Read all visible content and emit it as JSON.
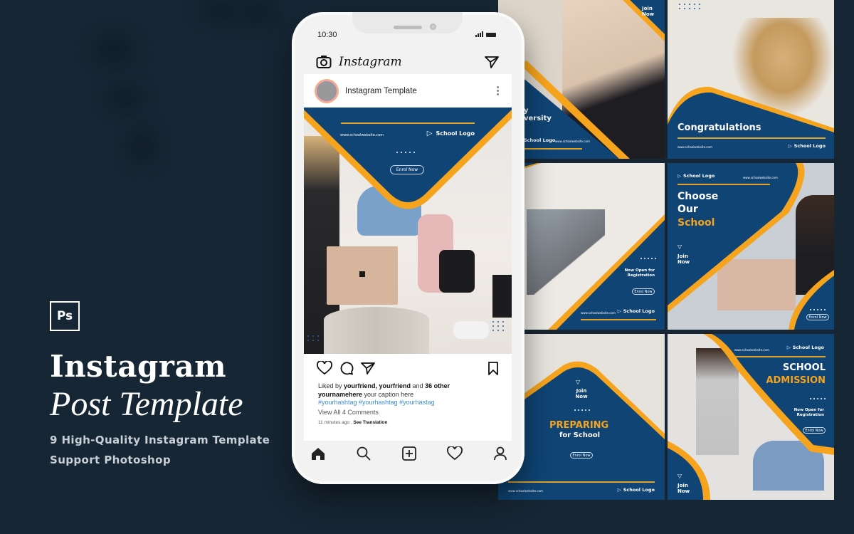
{
  "colors": {
    "background": "#172634",
    "navy": "#0f4474",
    "accent_orange": "#f6a41d",
    "hashtag_blue": "#3d8fd6"
  },
  "branding": {
    "badge": "Ps",
    "title": "Instagram",
    "subtitle": "Post Template",
    "line1": "9 High-Quality Instagram Template",
    "line2": "Support Photoshop"
  },
  "phone": {
    "status_time": "10:30",
    "app_name": "Instagram",
    "post": {
      "username": "Instagram Template",
      "website": "www.schoolwebsite.com",
      "logo": "School Logo",
      "enrol": "Enrol Now",
      "liked_prefix": "Liked by",
      "liked_names": "yourfriend, yourfriend",
      "liked_and": "and",
      "liked_count": "36 other",
      "caption_user": "yournamehere",
      "caption_text": "your caption here",
      "hashtags": "#yourhashtag #yourhashtag #yourhastag",
      "view_comments": "View All 4 Comments",
      "time_ago": "11 minutes ago",
      "see_translation": "See Translation"
    },
    "tabbar": [
      "home-icon",
      "search-icon",
      "add-post-icon",
      "heart-icon",
      "profile-icon"
    ]
  },
  "tiles": [
    {
      "join": "Join Now",
      "partial_headline_1": "y",
      "partial_headline_2": "versity",
      "logo": "School Logo",
      "website": "www.schoolwebsite.com"
    },
    {
      "headline": "Congratulations",
      "website": "www.schoolwebsite.com",
      "logo": "School Logo"
    },
    {
      "open": "Now Open for Registration",
      "enrol": "Enrol Now",
      "website": "www.schoolwebsite.com",
      "logo": "School Logo"
    },
    {
      "logo": "School Logo",
      "website": "www.schoolwebsite.com",
      "headline_1": "Choose",
      "headline_2": "Our",
      "headline_3": "School",
      "join": "Join Now",
      "enrol": "Enrol Now"
    },
    {
      "join": "Join Now",
      "headline_1": "PREPARING",
      "headline_2": "for School",
      "enrol": "Enrol Now",
      "website": "www.schoolwebsite.com",
      "logo": "School Logo"
    },
    {
      "website": "www.schoolwebsite.com",
      "logo": "School Logo",
      "headline_1": "SCHOOL",
      "headline_2": "ADMISSION",
      "open": "Now Open for Registration",
      "enrol": "Enrol Now",
      "join": "Join Now"
    }
  ]
}
